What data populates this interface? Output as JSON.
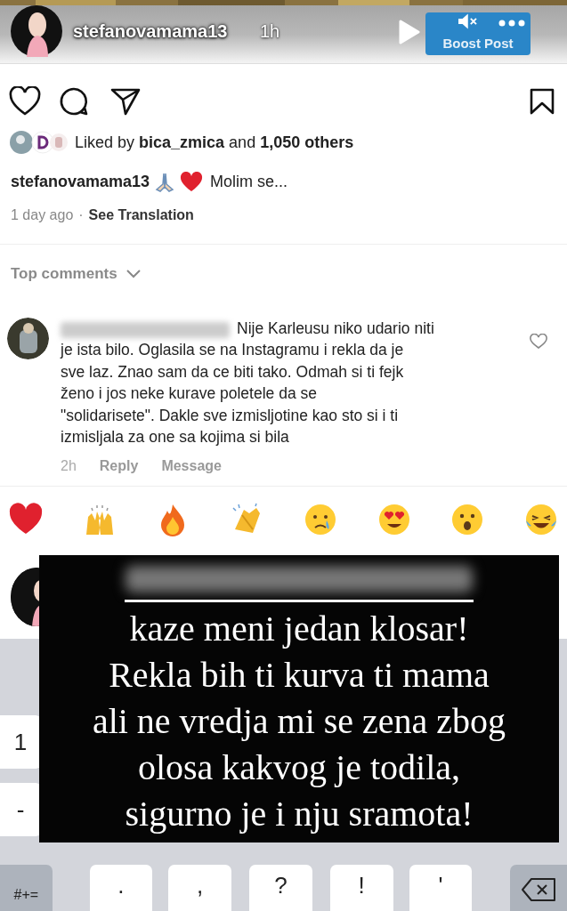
{
  "story_header": {
    "username": "stefanovamama13",
    "time": "1h"
  },
  "post": {
    "boost_button": "Boost Post",
    "likes": "Liked by **bica_zmica** and **1,050 others**",
    "caption": {
      "username": "stefanovamama13",
      "text": "Molim se..."
    },
    "age": "1 day ago",
    "separator": "·",
    "translate": "See Translation"
  },
  "comments_header": "Top comments",
  "comment": {
    "text": "Nije Karleusu niko udario niti\nje ista bilo. Oglasila se na Instagramu i rekla da je\nsve laz. Znao sam da ce biti tako. Odmah si ti fejk\nženo i jos neke kurave poletele da se\n\"solidarisete\". Dakle sve izmisljotine kao sto si i ti\nizmisljala za one sa kojima si bila",
    "time": "2h",
    "actions": [
      "Reply",
      "Message"
    ]
  },
  "overlay": {
    "lines": [
      "kaze meni jedan klosar!",
      "Rekla bih ti kurva ti mama",
      "ali ne vredja mi se zena zbog",
      "olosa kakvog je todila,",
      "sigurno je i nju sramota!"
    ]
  },
  "keyboard": {
    "side_keys": [
      "1",
      "-"
    ],
    "bottom_row": [
      {
        "kind": "mode",
        "label": "#+="
      },
      {
        "kind": "key",
        "label": "."
      },
      {
        "kind": "key",
        "label": ","
      },
      {
        "kind": "key",
        "label": "?"
      },
      {
        "kind": "key",
        "label": "!"
      },
      {
        "kind": "key",
        "label": "'"
      },
      {
        "kind": "backspace"
      }
    ]
  }
}
